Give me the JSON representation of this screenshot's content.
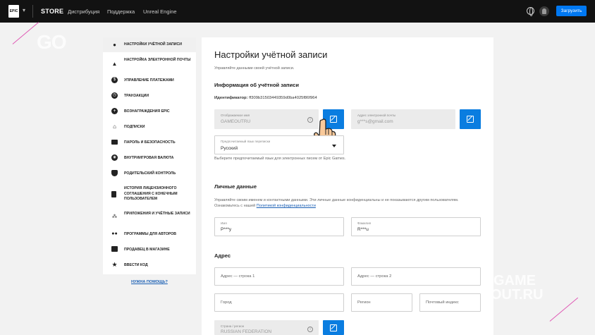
{
  "topnav": {
    "logo_text": "EPIC",
    "store": "STORE",
    "links": [
      "Дистрибуция",
      "Поддержка",
      "Unreal Engine"
    ],
    "download": "Загрузить"
  },
  "sidebar": {
    "items": [
      {
        "label": "Настройки учётной записи",
        "icon": "person-icon",
        "glyph": "👤"
      },
      {
        "label": "Настройка электронной почты",
        "icon": "bell-icon",
        "glyph": "🔔"
      },
      {
        "label": "Управление платежами",
        "icon": "dollar-icon",
        "glyph": "$"
      },
      {
        "label": "Транзакции",
        "icon": "clock-icon",
        "glyph": "◷"
      },
      {
        "label": "Вознаграждения Epic",
        "icon": "plus-circle-icon",
        "glyph": "⊕"
      },
      {
        "label": "Подписки",
        "icon": "house-icon",
        "glyph": "⌂"
      },
      {
        "label": "Пароль и безопасность",
        "icon": "lock-icon",
        "glyph": "🔒"
      },
      {
        "label": "Внутриигровая валюта",
        "icon": "coins-icon",
        "glyph": "◎"
      },
      {
        "label": "Родительский контроль",
        "icon": "shield-icon",
        "glyph": "⛨"
      },
      {
        "label": "История лицензионного соглашения с конечным пользователем",
        "icon": "document-icon",
        "glyph": "▤"
      },
      {
        "label": "Приложения и учётные записи",
        "icon": "apps-icon",
        "glyph": "⁂"
      },
      {
        "label": "Программы для авторов",
        "icon": "people-icon",
        "glyph": "👥"
      },
      {
        "label": "Продавец в магазине",
        "icon": "store-icon",
        "glyph": "▦"
      },
      {
        "label": "Ввести код",
        "icon": "star-icon",
        "glyph": "★"
      }
    ],
    "help": "НУЖНА ПОМОЩЬ?"
  },
  "main": {
    "title": "Настройки учётной записи",
    "subtitle": "Управляйте данными своей учётной записи.",
    "account_info": {
      "heading": "Информация об учётной записи",
      "id_label": "Идентификатор:",
      "id_value": "ff309b31503449359d0ba4025f86f964",
      "display_name_label": "Отображаемое имя",
      "display_name_value": "GAMEOUTRU",
      "email_label": "Адрес электронной почты",
      "email_value": "g***s@gmail.com",
      "lang_label": "Предпочитаемый язык переписки",
      "lang_value": "Русский",
      "lang_hint": "Выберите предпочитаемый язык для электронных писем от Epic Games."
    },
    "personal": {
      "heading": "Личные данные",
      "text": "Управляйте своим именем и контактными данными. Эти личные данные конфиденциальны и не показываются другим пользователям. Ознакомьтесь с нашей",
      "link": "Политикой конфиденциальности",
      "first_label": "Имя",
      "first_value": "P***y",
      "last_label": "Фамилия",
      "last_value": "R***u"
    },
    "address": {
      "heading": "Адрес",
      "line1": "Адрес — строка 1",
      "line2": "Адрес — строка 2",
      "city": "Город",
      "region": "Регион",
      "zip": "Почтовый индекс",
      "country_label": "Страна / регион",
      "country_value": "RUSSIAN FEDERATION"
    }
  },
  "watermark": {
    "go": "GO",
    "game": "GAME",
    "out": "OUT.RU"
  },
  "colors": {
    "accent": "#0a7de0",
    "topbar": "#121212",
    "download": "#0078f2",
    "link": "#1a5fb4"
  }
}
